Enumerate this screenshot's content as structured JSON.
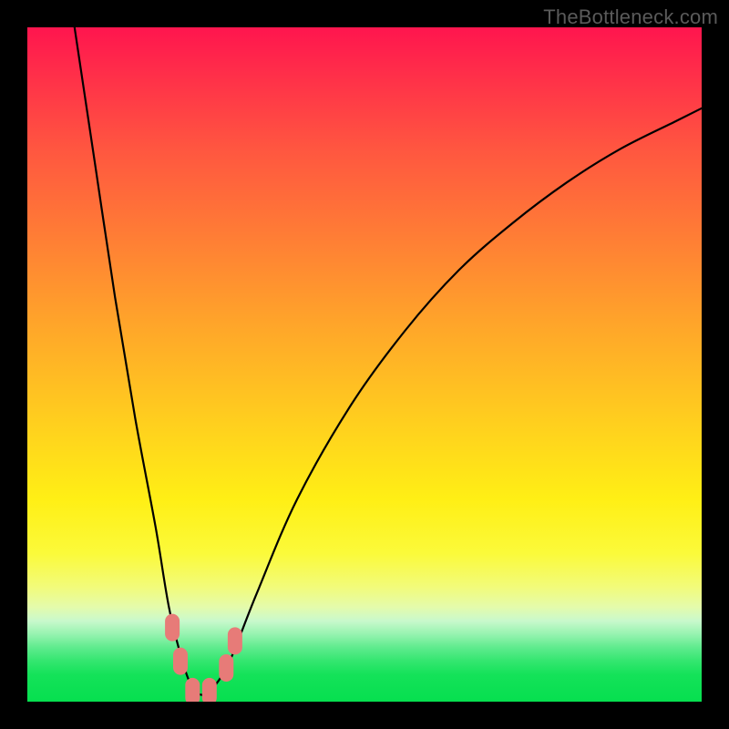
{
  "watermark": "TheBottleneck.com",
  "chart_data": {
    "type": "line",
    "title": "",
    "xlabel": "",
    "ylabel": "",
    "xlim": [
      0,
      100
    ],
    "ylim": [
      0,
      100
    ],
    "series": [
      {
        "name": "bottleneck-curve",
        "x": [
          7,
          10,
          13,
          16,
          19,
          21,
          23,
          24.5,
          26,
          27.5,
          30,
          34,
          40,
          48,
          56,
          64,
          72,
          80,
          88,
          96,
          100
        ],
        "y": [
          100,
          80,
          60,
          42,
          26,
          14,
          6,
          2,
          1,
          2,
          6,
          16,
          30,
          44,
          55,
          64,
          71,
          77,
          82,
          86,
          88
        ]
      }
    ],
    "markers": [
      {
        "name": "marker-left-1",
        "x": 21.5,
        "y": 11
      },
      {
        "name": "marker-left-2",
        "x": 22.7,
        "y": 6
      },
      {
        "name": "marker-trough-1",
        "x": 24.5,
        "y": 1.5
      },
      {
        "name": "marker-trough-2",
        "x": 27.0,
        "y": 1.5
      },
      {
        "name": "marker-right-1",
        "x": 29.5,
        "y": 5
      },
      {
        "name": "marker-right-2",
        "x": 30.8,
        "y": 9
      }
    ],
    "marker_color": "#e77b78",
    "curve_color": "#000000"
  }
}
